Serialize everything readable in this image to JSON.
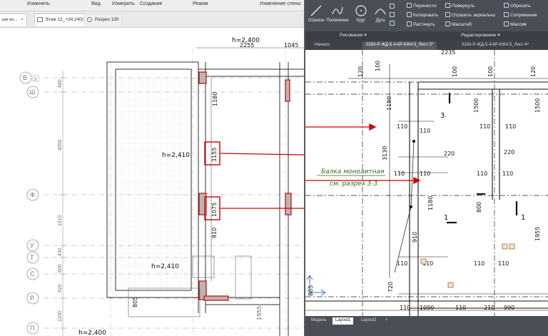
{
  "revit": {
    "menu": [
      "Изменить",
      "Вид",
      "Измерить",
      "Создание",
      "Режим",
      "Изменение стены"
    ],
    "tabs": [
      {
        "label": "ые ко...",
        "close": "×"
      },
      {
        "label": "Этаж 12_+34,240(1)"
      },
      {
        "label": "Разрез 135"
      }
    ],
    "annotations": {
      "h_top": "h=2,400",
      "h_mid": "h=2,410",
      "h_low": "h=2,410",
      "h_bottom": "h=2,400",
      "dim_2255": "2255",
      "dim_1045": "1045",
      "dim_1180": "1180",
      "dim_3155": "3155",
      "dim_1075": "1075",
      "dim_910": "910",
      "dim_805": "805",
      "dim_1955": "1955"
    },
    "axes_letters": [
      "В",
      "Э",
      "Ш",
      "Ф",
      "У",
      "Т",
      "С",
      "Р",
      "П"
    ],
    "axes_dims": [
      "480",
      "4050",
      "1910",
      "430",
      "600",
      "920",
      "1100"
    ]
  },
  "autocad": {
    "draw_tools": {
      "segment": "Отрезок",
      "polyline": "Полилиния",
      "circle": "Круг",
      "arc": "Дуга"
    },
    "modify_tools": {
      "move": "Перенести",
      "rotate": "Повернуть",
      "trim": "Обрезать",
      "copy": "Копировать",
      "mirror": "Отразить зеркально",
      "fillet": "Сопряжение",
      "stretch": "Растянуть",
      "scale": "Масштаб",
      "array": "Массив"
    },
    "panels": {
      "draw": "Рисование ▾",
      "modify": "Редактирование ▾"
    },
    "doc_tabs": [
      "Начало",
      "0283-Р-ЖД-5.4-КР-КЖ4.5_Лист-3*",
      "0283-Р-ЖД-5.4-КР-КЖ4.5_Лист-4*"
    ],
    "plus": "+",
    "note_line1": "Балка монолитная",
    "note_line2": "см. разрез 3-3",
    "section_marks": {
      "s3": "3",
      "s1a": "1",
      "s1b": "1"
    },
    "dims": {
      "d120": "120",
      "d100": "100",
      "d2235": "2235",
      "d1180": "1180",
      "d1500": "1500",
      "d110": "110",
      "d220": "220",
      "d3130": "3130",
      "d800": "800",
      "d910": "910",
      "d1955": "1955",
      "d1090": "1090",
      "d990": "990",
      "d805": "805",
      "d720": "720",
      "d210": "210"
    },
    "layout_tabs": [
      "Модель",
      "Layout1",
      "Layout2",
      "+"
    ]
  },
  "colors": {
    "red_highlight": "#cc0000",
    "ac_dark": "#4a4f57",
    "note_green": "#2a6a1a"
  }
}
